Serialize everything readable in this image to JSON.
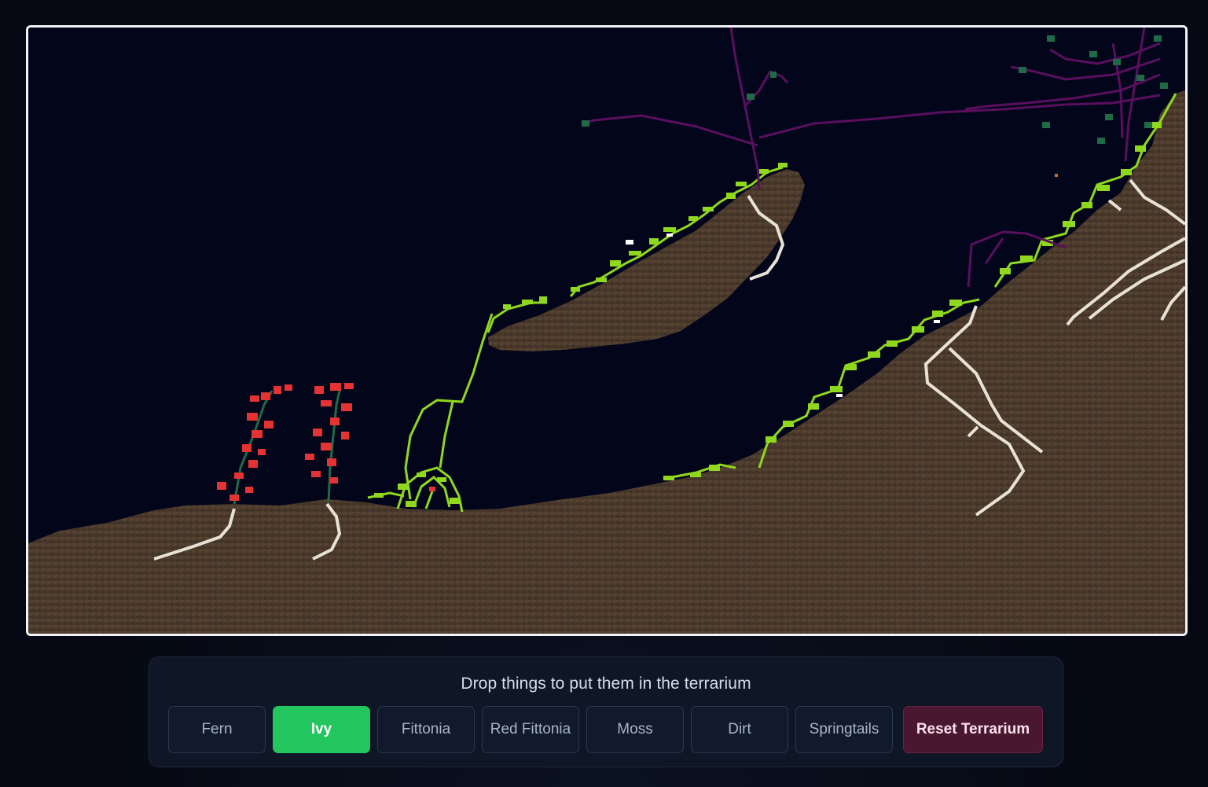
{
  "toolbar": {
    "title": "Drop things to put them in the terrarium",
    "buttons": [
      {
        "label": "Fern",
        "active": false
      },
      {
        "label": "Ivy",
        "active": true
      },
      {
        "label": "Fittonia",
        "active": false
      },
      {
        "label": "Red Fittonia",
        "active": false
      },
      {
        "label": "Moss",
        "active": false
      },
      {
        "label": "Dirt",
        "active": false
      },
      {
        "label": "Springtails",
        "active": false
      }
    ],
    "reset_label": "Reset Terrarium"
  },
  "colors": {
    "accent": "#22c55e",
    "reset": "#4a1730",
    "sky": "#03061a",
    "dirt": "#4b3a2e",
    "root": "#e8e2d6",
    "ivy": "#8fd81e",
    "fittonia_red": "#e53232",
    "fern_purple": "#5a0f5e",
    "leaf_dark_green": "#1f6b48"
  }
}
